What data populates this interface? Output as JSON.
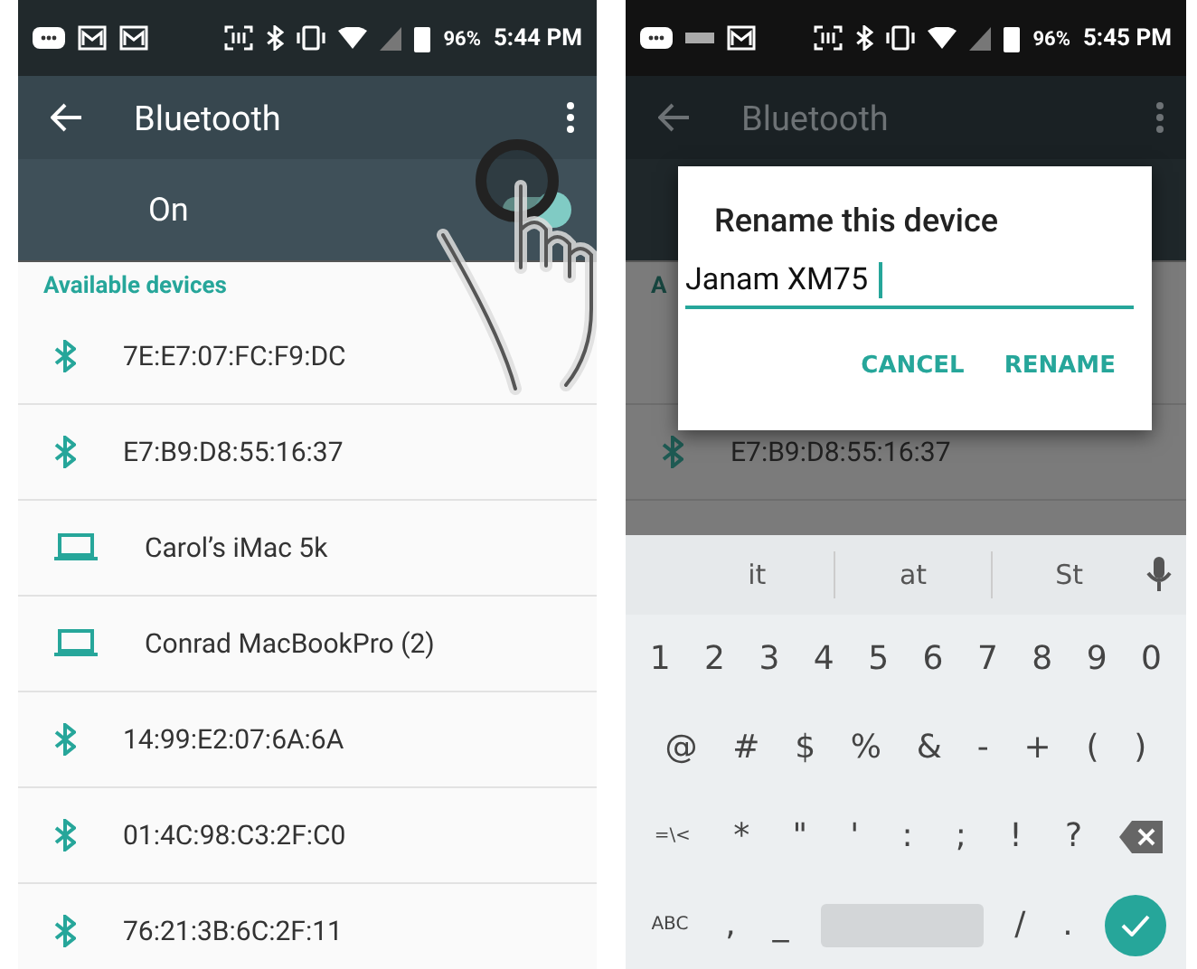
{
  "screens": [
    {
      "dimmed": false,
      "status_bar": {
        "battery": "96%",
        "time": "5:44 PM"
      },
      "toolbar": {
        "title": "Bluetooth"
      },
      "switch": {
        "label": "On",
        "on": true
      },
      "section_header": "Available devices",
      "devices": [
        {
          "kind": "bluetooth",
          "name": "7E:E7:07:FC:F9:DC"
        },
        {
          "kind": "bluetooth",
          "name": "E7:B9:D8:55:16:37"
        },
        {
          "kind": "laptop",
          "name": "Carol’s iMac 5k"
        },
        {
          "kind": "laptop",
          "name": "Conrad MacBookPro (2)"
        },
        {
          "kind": "bluetooth",
          "name": "14:99:E2:07:6A:6A"
        },
        {
          "kind": "bluetooth",
          "name": "01:4C:98:C3:2F:C0"
        },
        {
          "kind": "bluetooth",
          "name": "76:21:3B:6C:2F:11"
        }
      ],
      "tap_gesture": true
    },
    {
      "dimmed": true,
      "status_bar": {
        "battery": "96%",
        "time": "5:45 PM"
      },
      "toolbar": {
        "title": "Bluetooth"
      },
      "section_header": "A",
      "devices": [
        {
          "kind": "hidden"
        },
        {
          "kind": "bluetooth",
          "name": "E7:B9:D8:55:16:37"
        }
      ],
      "dialog": {
        "title": "Rename this device",
        "value": "Janam XM75",
        "buttons": [
          "CANCEL",
          "RENAME"
        ]
      },
      "keyboard": {
        "suggestions": [
          "it",
          "at",
          "St"
        ],
        "digit_keys": [
          "1",
          "2",
          "3",
          "4",
          "5",
          "6",
          "7",
          "8",
          "9",
          "0"
        ],
        "symbol_keys": [
          "@",
          "#",
          "$",
          "%",
          "&",
          "-",
          "+",
          "(",
          ")"
        ],
        "punctuation_keys": [
          "=\\<",
          "*",
          "\"",
          "'",
          ":",
          ";",
          "!",
          "?"
        ],
        "bottom_keys": [
          "ABC",
          ",",
          "_",
          "/",
          "."
        ]
      }
    }
  ]
}
